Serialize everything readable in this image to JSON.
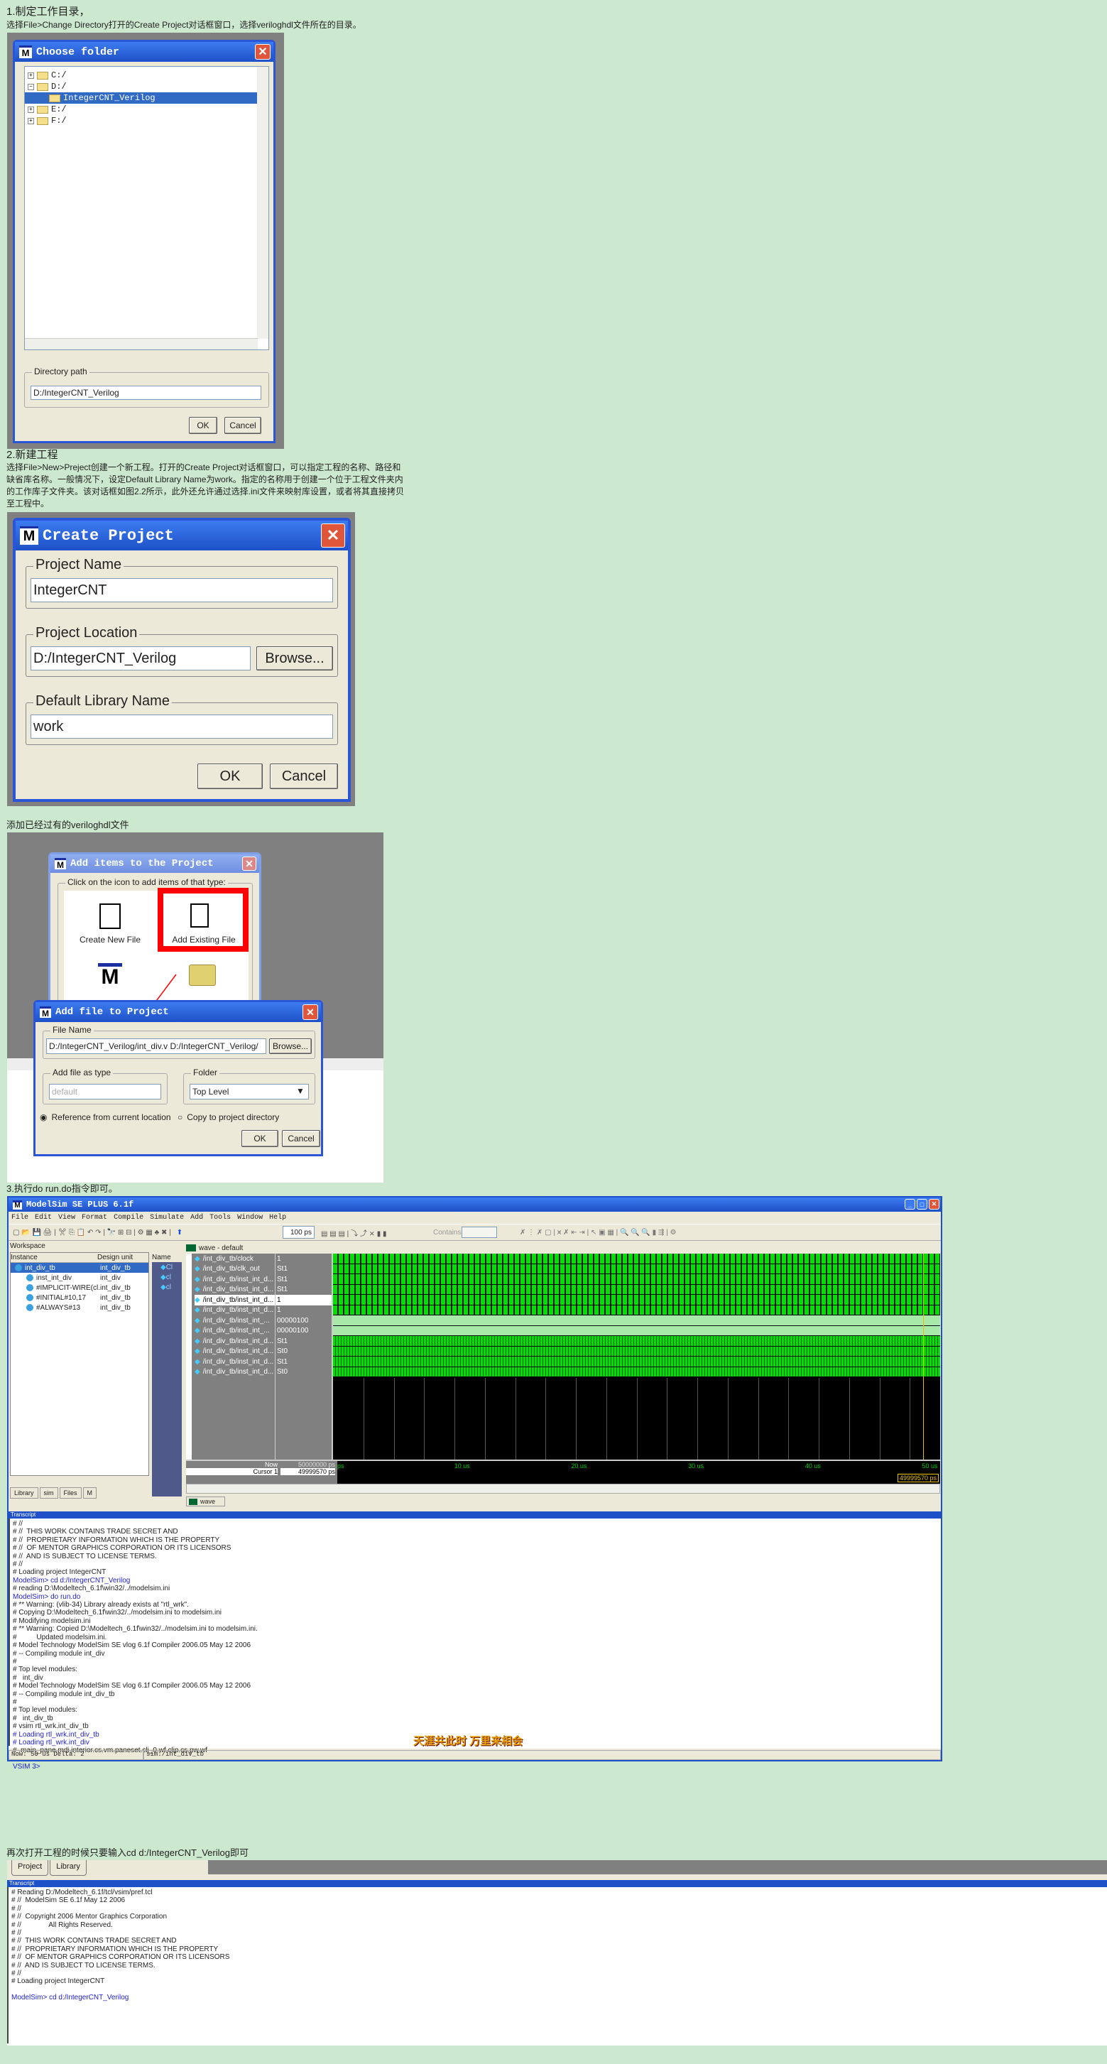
{
  "section1": {
    "heading": "1.制定工作目录，",
    "desc": "选择File>Change Directory打开的Create Project对话框窗口，选择veriloghdl文件所在的目录。"
  },
  "choose_folder": {
    "title": "Choose folder",
    "tree": [
      {
        "label": "C:/",
        "expand": "+"
      },
      {
        "label": "D:/",
        "expand": "−"
      },
      {
        "label": "IntegerCNT_Verilog",
        "expand": "",
        "selected": true
      },
      {
        "label": "E:/",
        "expand": "+"
      },
      {
        "label": "F:/",
        "expand": "+"
      }
    ],
    "path_label": "Directory path",
    "path_value": "D:/IntegerCNT_Verilog",
    "ok": "OK",
    "cancel": "Cancel"
  },
  "section2": {
    "heading": "2.新建工程",
    "desc_lines": [
      "选择File>New>Preject创建一个新工程。打开的Create Project对话框窗口，可以指定工程的名称、路径和",
      "缺省库名称。一般情况下，设定Default Library Name为work。指定的名称用于创建一个位于工程文件夹内",
      "的工作库子文件夹。该对话框如图2.2所示，此外还允许通过选择.ini文件来映射库设置，或者将其直接拷贝",
      "至工程中。"
    ]
  },
  "create_project": {
    "title": "Create Project",
    "name_label": "Project Name",
    "name_value": "IntegerCNT",
    "loc_label": "Project Location",
    "loc_value": "D:/IntegerCNT_Verilog",
    "browse": "Browse...",
    "lib_label": "Default Library Name",
    "lib_value": "work",
    "ok": "OK",
    "cancel": "Cancel"
  },
  "section_add": {
    "text": "添加已经过有的veriloghdl文件"
  },
  "add_items": {
    "title": "Add items to the Project",
    "group": "Click on the icon to add items of that type:",
    "create_new": "Create New File",
    "add_existing": "Add Existing File",
    "highlight_color": "#ff0000"
  },
  "add_file": {
    "title": "Add file to Project",
    "file_label": "File Name",
    "file_value": "D:/IntegerCNT_Verilog/int_div.v D:/IntegerCNT_Verilog/",
    "browse": "Browse...",
    "type_label": "Add file as type",
    "type_value": "default",
    "folder_label": "Folder",
    "folder_value": "Top Level",
    "radio_ref": "Reference from current location",
    "radio_copy": "Copy to project directory",
    "radio_selected": "ref",
    "ok": "OK",
    "cancel": "Cancel"
  },
  "section3": {
    "text": "3.执行do run.do指令即可。"
  },
  "modelsim": {
    "title": "ModelSim SE PLUS 6.1f",
    "menu": [
      "File",
      "Edit",
      "View",
      "Format",
      "Compile",
      "Simulate",
      "Add",
      "Tools",
      "Window",
      "Help"
    ],
    "run_length": "100 ps",
    "contains_label": "Contains:",
    "workspace": {
      "title": "Workspace",
      "cols": [
        "Instance",
        "Design unit"
      ],
      "rows": [
        {
          "inst": "int_div_tb",
          "unit": "int_div_tb",
          "selected": true
        },
        {
          "inst": "inst_int_div",
          "unit": "int_div"
        },
        {
          "inst": "#IMPLICIT-WIRE(cl...",
          "unit": "int_div_tb"
        },
        {
          "inst": "#INITIAL#10,17",
          "unit": "int_div_tb"
        },
        {
          "inst": "#ALWAYS#13",
          "unit": "int_div_tb"
        }
      ],
      "tabs": [
        "Library",
        "sim",
        "Files",
        "M"
      ]
    },
    "objects": {
      "col": "Name",
      "items": [
        "Cl",
        "cl",
        "cl"
      ]
    },
    "wave": {
      "title": "wave - default",
      "signals": [
        {
          "name": "/int_div_tb/clock",
          "value": "1",
          "style": "clk"
        },
        {
          "name": "/int_div_tb/clk_out",
          "value": "St1",
          "style": "clk"
        },
        {
          "name": "/int_div_tb/inst_int_d...",
          "value": "St1",
          "style": "clk"
        },
        {
          "name": "/int_div_tb/inst_int_d...",
          "value": "St1",
          "style": "clk"
        },
        {
          "name": "/int_div_tb/inst_int_d...",
          "value": "1",
          "style": "clk",
          "selected": true
        },
        {
          "name": "/int_div_tb/inst_int_d...",
          "value": "1",
          "style": "clk"
        },
        {
          "name": "/int_div_tb/inst_int_...",
          "value": "00000100",
          "style": "lt"
        },
        {
          "name": "/int_div_tb/inst_int_...",
          "value": "00000100",
          "style": "lt"
        },
        {
          "name": "/int_div_tb/inst_int_d...",
          "value": "St1",
          "style": "clk2"
        },
        {
          "name": "/int_div_tb/inst_int_d...",
          "value": "St0",
          "style": "clk2"
        },
        {
          "name": "/int_div_tb/inst_int_d...",
          "value": "St1",
          "style": "clk2"
        },
        {
          "name": "/int_div_tb/inst_int_d...",
          "value": "St0",
          "style": "clk2"
        }
      ],
      "now_label": "Now",
      "now_value": "50000000 ps",
      "cursor_label": "Cursor 1",
      "cursor_value": "49999570 ps",
      "ticks": [
        "ps",
        "10 us",
        "20 us",
        "30 us",
        "40 us",
        "50 us"
      ],
      "cursor_flag": "49999570 ps",
      "tab": "wave"
    },
    "transcript": {
      "title": "Transcript",
      "lines": [
        {
          "t": "# //"
        },
        {
          "t": "# //  THIS WORK CONTAINS TRADE SECRET AND"
        },
        {
          "t": "# //  PROPRIETARY INFORMATION WHICH IS THE PROPERTY"
        },
        {
          "t": "# //  OF MENTOR GRAPHICS CORPORATION OR ITS LICENSORS"
        },
        {
          "t": "# //  AND IS SUBJECT TO LICENSE TERMS."
        },
        {
          "t": "# //"
        },
        {
          "t": "# Loading project IntegerCNT"
        },
        {
          "t": "ModelSim> cd d:/IntegerCNT_Verilog",
          "p": true
        },
        {
          "t": "# reading D:\\Modeltech_6.1f\\win32/../modelsim.ini"
        },
        {
          "t": "ModelSim> do run.do",
          "p": true
        },
        {
          "t": "# ** Warning: (vlib-34) Library already exists at \"rtl_wrk\"."
        },
        {
          "t": "# Copying D:\\Modeltech_6.1f\\win32/../modelsim.ini to modelsim.ini"
        },
        {
          "t": "# Modifying modelsim.ini"
        },
        {
          "t": "# ** Warning: Copied D:\\Modeltech_6.1f\\win32/../modelsim.ini to modelsim.ini."
        },
        {
          "t": "#          Updated modelsim.ini."
        },
        {
          "t": "# Model Technology ModelSim SE vlog 6.1f Compiler 2006.05 May 12 2006"
        },
        {
          "t": "# -- Compiling module int_div"
        },
        {
          "t": "#"
        },
        {
          "t": "# Top level modules:"
        },
        {
          "t": "#   int_div"
        },
        {
          "t": "# Model Technology ModelSim SE vlog 6.1f Compiler 2006.05 May 12 2006"
        },
        {
          "t": "# -- Compiling module int_div_tb"
        },
        {
          "t": "#"
        },
        {
          "t": "# Top level modules:"
        },
        {
          "t": "#   int_div_tb"
        },
        {
          "t": "# vsim rtl_wrk.int_div_tb"
        },
        {
          "t": "# Loading rtl_wrk.int_div_tb",
          "b": true
        },
        {
          "t": "# Loading rtl_wrk.int_div",
          "b": true
        },
        {
          "t": "# .main_pane.mdi.interior.cs.vm.paneset.cli_0.wf.clip.cs.pw.wf"
        },
        {
          "t": ""
        },
        {
          "t": "VSIM 3>",
          "p": true
        }
      ]
    },
    "watermark": "天涯共此时 万里来相会",
    "status": {
      "now": "Now: 50 us   Delta: 2",
      "path": "sim:/int_div_tb"
    }
  },
  "section4": {
    "text": "再次打开工程的时候只要输入cd d:/IntegerCNT_Verilog即可"
  },
  "reopen": {
    "tabs": [
      "Project",
      "Library"
    ],
    "transcript_title": "Transcript",
    "lines": [
      {
        "t": "# Reading D:/Modeltech_6.1f/tcl/vsim/pref.tcl"
      },
      {
        "t": "# //  ModelSim SE 6.1f May 12 2006"
      },
      {
        "t": "# //"
      },
      {
        "t": "# //  Copyright 2006 Mentor Graphics Corporation"
      },
      {
        "t": "# //              All Rights Reserved."
      },
      {
        "t": "# //"
      },
      {
        "t": "# //  THIS WORK CONTAINS TRADE SECRET AND"
      },
      {
        "t": "# //  PROPRIETARY INFORMATION WHICH IS THE PROPERTY"
      },
      {
        "t": "# //  OF MENTOR GRAPHICS CORPORATION OR ITS LICENSORS"
      },
      {
        "t": "# //  AND IS SUBJECT TO LICENSE TERMS."
      },
      {
        "t": "# //"
      },
      {
        "t": "# Loading project IntegerCNT"
      },
      {
        "t": ""
      },
      {
        "t": "ModelSim> cd d:/IntegerCNT_Verilog",
        "p": true
      }
    ]
  }
}
